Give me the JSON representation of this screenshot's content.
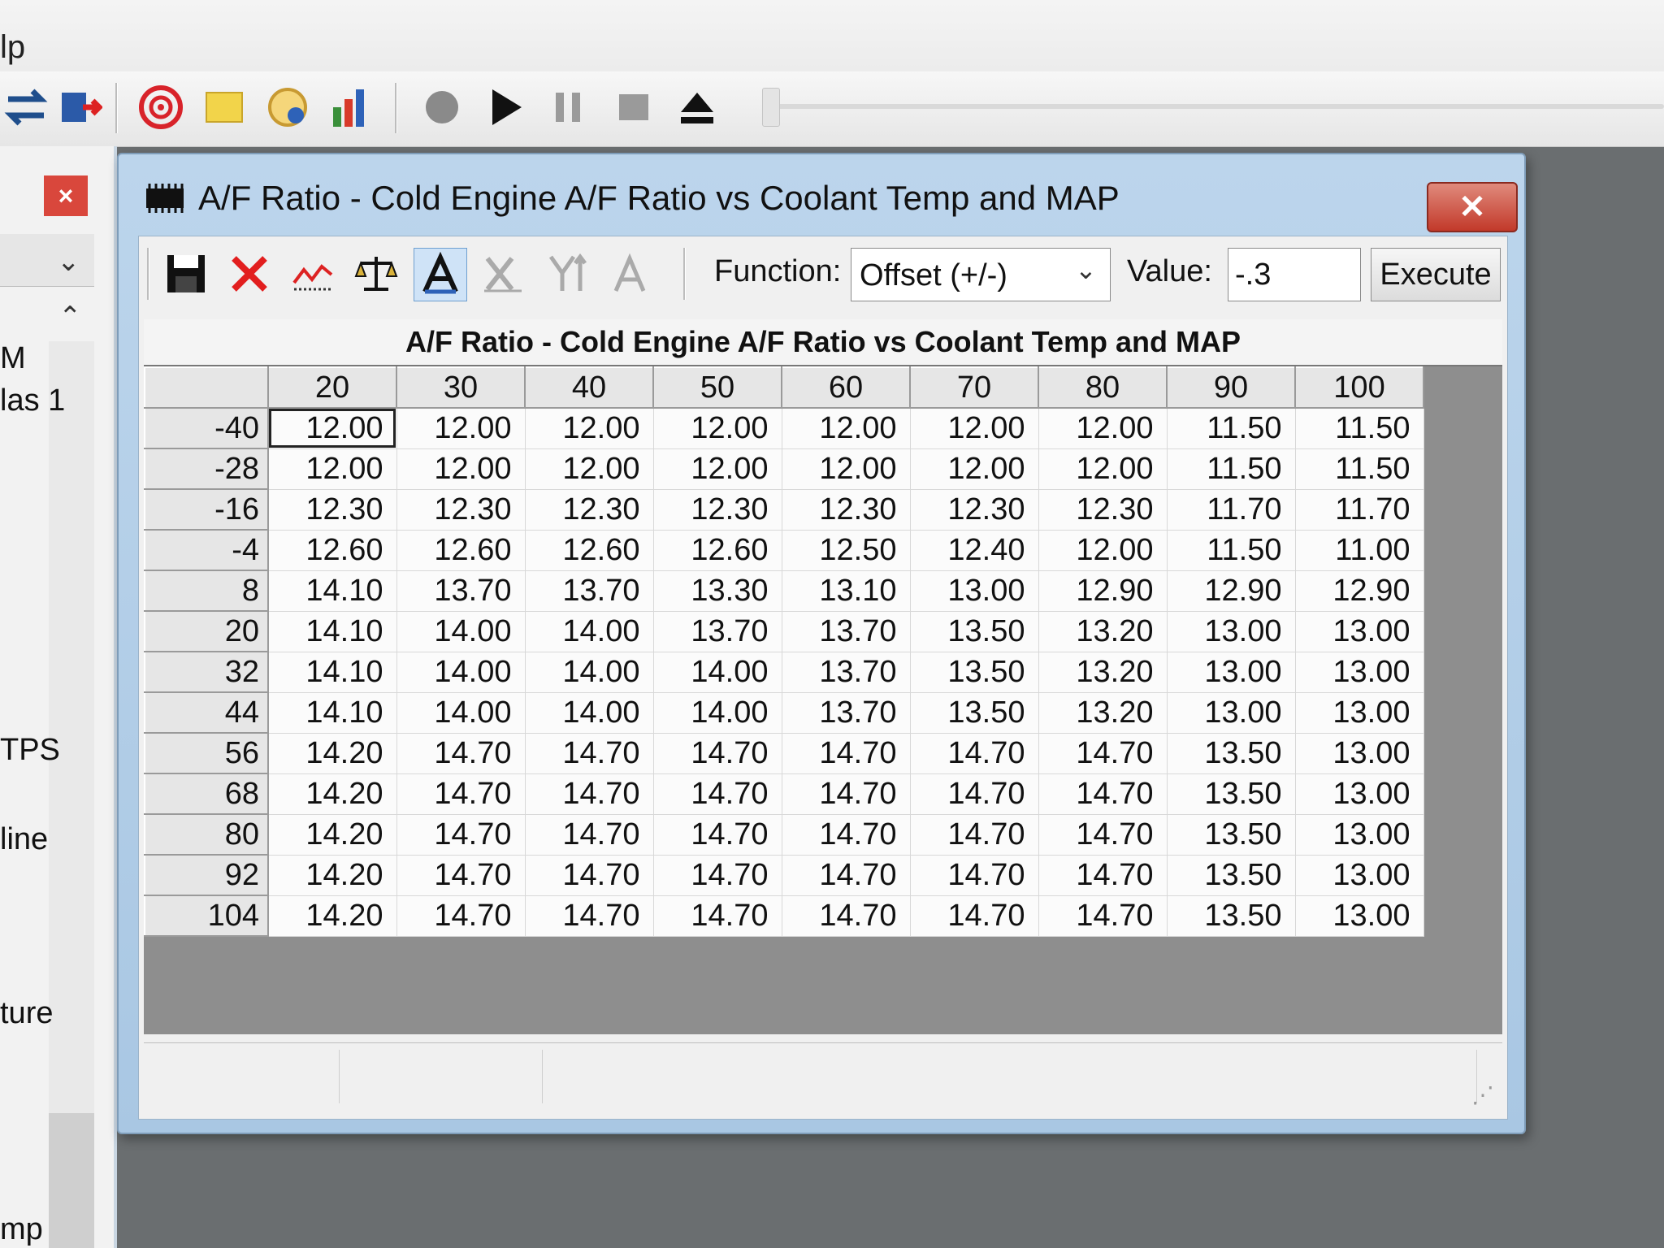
{
  "menu": {
    "help_fragment": "lp"
  },
  "left_panel": {
    "close_label": "×",
    "labels": [
      "M",
      "las 1",
      "TPS",
      "line",
      "ture",
      "mp"
    ]
  },
  "dialog": {
    "title": "A/F Ratio - Cold Engine A/F Ratio vs Coolant Temp and MAP",
    "close_label": "✕",
    "toolbar": {
      "function_label": "Function:",
      "function_value": "Offset (+/-)",
      "value_label": "Value:",
      "value": "-.3",
      "execute_label": "Execute"
    },
    "table": {
      "title": "A/F Ratio - Cold Engine A/F Ratio vs Coolant Temp and MAP",
      "columns": [
        "20",
        "30",
        "40",
        "50",
        "60",
        "70",
        "80",
        "90",
        "100"
      ],
      "rows": [
        {
          "label": "-40",
          "values": [
            "12.00",
            "12.00",
            "12.00",
            "12.00",
            "12.00",
            "12.00",
            "12.00",
            "11.50",
            "11.50"
          ]
        },
        {
          "label": "-28",
          "values": [
            "12.00",
            "12.00",
            "12.00",
            "12.00",
            "12.00",
            "12.00",
            "12.00",
            "11.50",
            "11.50"
          ]
        },
        {
          "label": "-16",
          "values": [
            "12.30",
            "12.30",
            "12.30",
            "12.30",
            "12.30",
            "12.30",
            "12.30",
            "11.70",
            "11.70"
          ]
        },
        {
          "label": "-4",
          "values": [
            "12.60",
            "12.60",
            "12.60",
            "12.60",
            "12.50",
            "12.40",
            "12.00",
            "11.50",
            "11.00"
          ]
        },
        {
          "label": "8",
          "values": [
            "14.10",
            "13.70",
            "13.70",
            "13.30",
            "13.10",
            "13.00",
            "12.90",
            "12.90",
            "12.90"
          ]
        },
        {
          "label": "20",
          "values": [
            "14.10",
            "14.00",
            "14.00",
            "13.70",
            "13.70",
            "13.50",
            "13.20",
            "13.00",
            "13.00"
          ]
        },
        {
          "label": "32",
          "values": [
            "14.10",
            "14.00",
            "14.00",
            "14.00",
            "13.70",
            "13.50",
            "13.20",
            "13.00",
            "13.00"
          ]
        },
        {
          "label": "44",
          "values": [
            "14.10",
            "14.00",
            "14.00",
            "14.00",
            "13.70",
            "13.50",
            "13.20",
            "13.00",
            "13.00"
          ]
        },
        {
          "label": "56",
          "values": [
            "14.20",
            "14.70",
            "14.70",
            "14.70",
            "14.70",
            "14.70",
            "14.70",
            "13.50",
            "13.00"
          ]
        },
        {
          "label": "68",
          "values": [
            "14.20",
            "14.70",
            "14.70",
            "14.70",
            "14.70",
            "14.70",
            "14.70",
            "13.50",
            "13.00"
          ]
        },
        {
          "label": "80",
          "values": [
            "14.20",
            "14.70",
            "14.70",
            "14.70",
            "14.70",
            "14.70",
            "14.70",
            "13.50",
            "13.00"
          ]
        },
        {
          "label": "92",
          "values": [
            "14.20",
            "14.70",
            "14.70",
            "14.70",
            "14.70",
            "14.70",
            "14.70",
            "13.50",
            "13.00"
          ]
        },
        {
          "label": "104",
          "values": [
            "14.20",
            "14.70",
            "14.70",
            "14.70",
            "14.70",
            "14.70",
            "14.70",
            "13.50",
            "13.00"
          ]
        }
      ],
      "selected_cell": {
        "row": 0,
        "col": 0
      }
    }
  },
  "colors": {
    "close_red": "#c2392a",
    "title_bar_blue": "#bcd5ec",
    "active_tool": "#cfe3f7"
  },
  "icons": {
    "app_toolbar": [
      "transfer-arrows-icon",
      "import-chip-icon",
      "target-icon",
      "note-icon",
      "gauge-icon",
      "bar-chart-icon",
      "record-icon",
      "play-icon",
      "pause-icon",
      "stop-icon",
      "eject-icon"
    ],
    "dialog_toolbar": [
      "save-icon",
      "delete-icon",
      "graph-icon",
      "balance-icon",
      "font-a-active-icon",
      "x-axis-icon",
      "y-axis-icon",
      "font-a-icon"
    ]
  }
}
